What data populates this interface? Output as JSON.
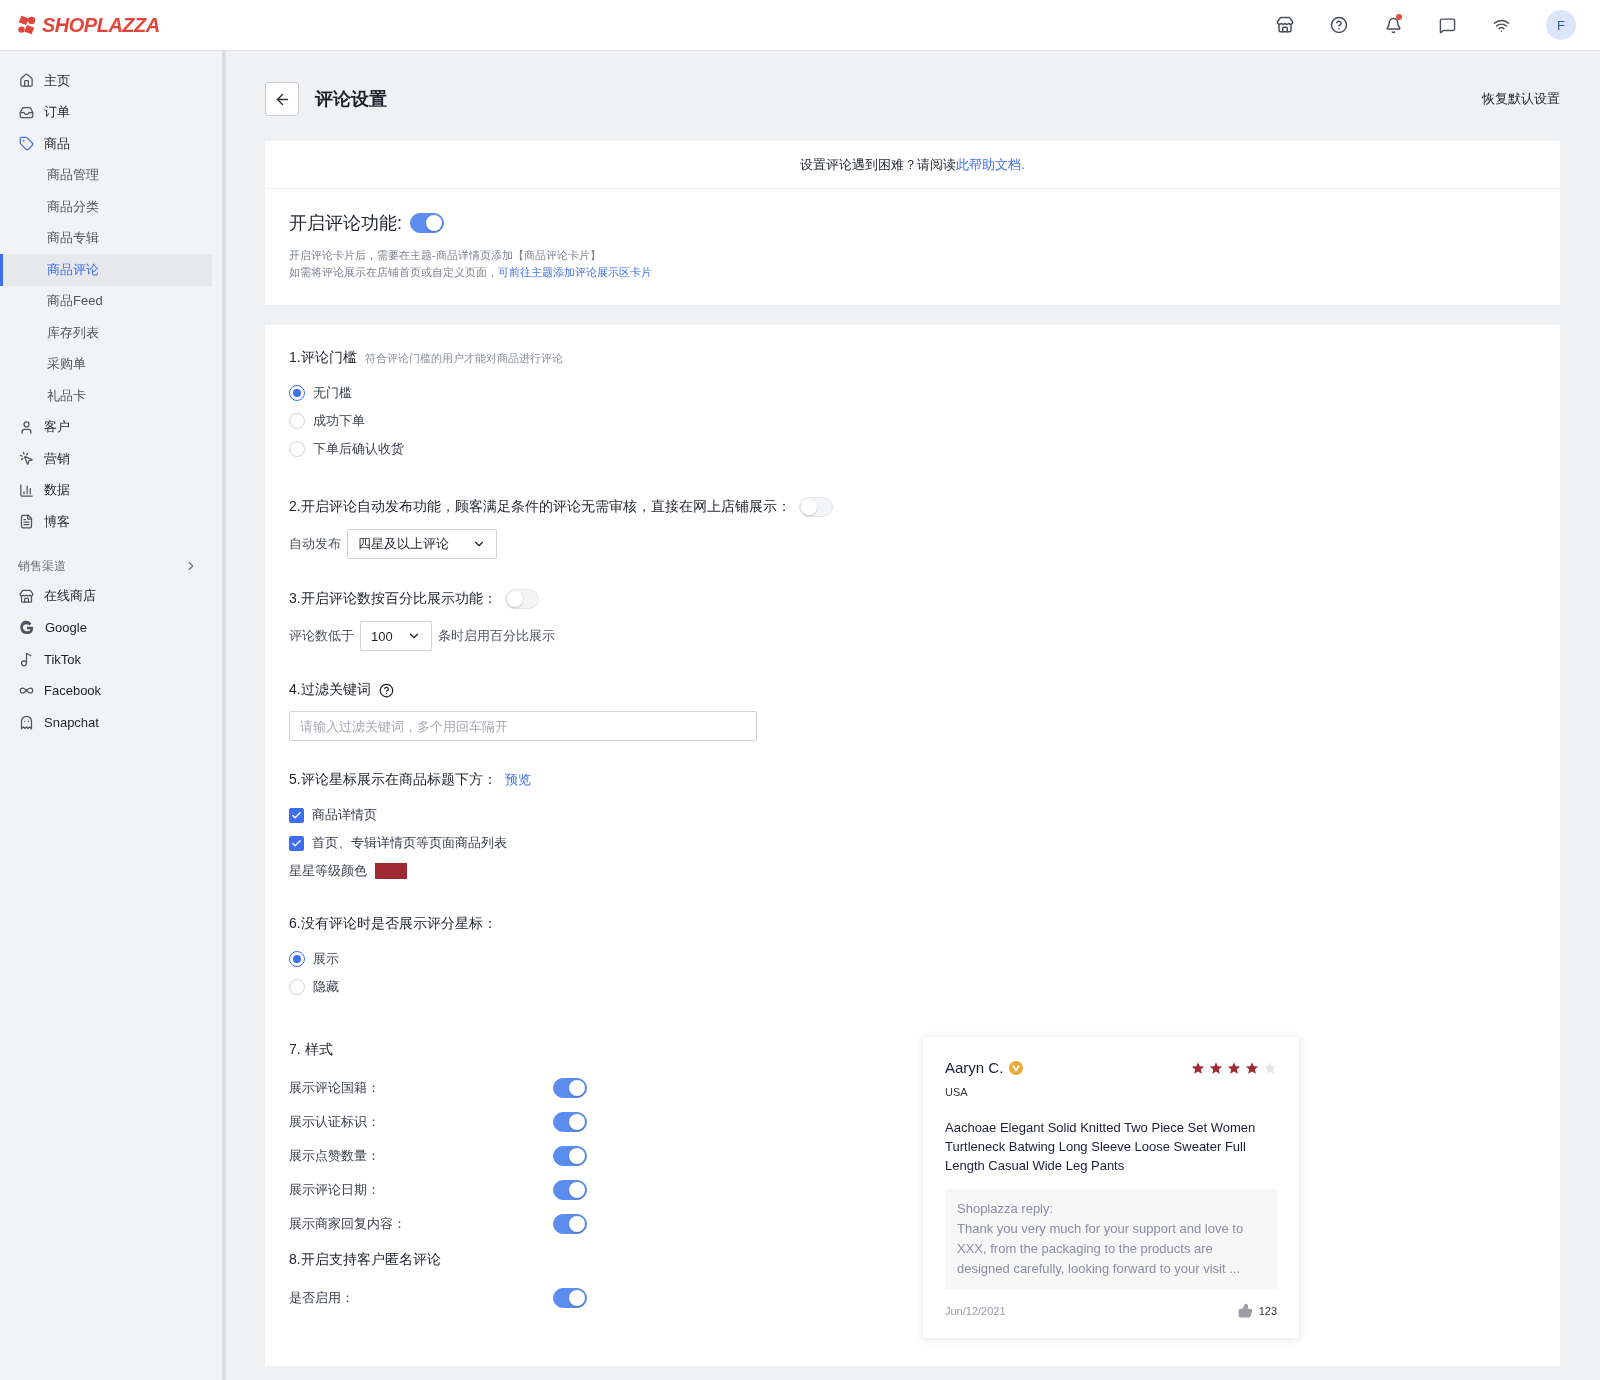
{
  "topbar": {
    "logo": "SHOPLAZZA",
    "has_notification": true,
    "avatar": "F"
  },
  "sidebar": {
    "items": [
      {
        "label": "主页",
        "selected": false
      },
      {
        "label": "订单",
        "selected": false
      },
      {
        "label": "商品",
        "selected": false,
        "expanded": true,
        "children": [
          {
            "label": "商品管理",
            "selected": false
          },
          {
            "label": "商品分类",
            "selected": false
          },
          {
            "label": "商品专辑",
            "selected": false
          },
          {
            "label": "商品评论",
            "selected": true
          },
          {
            "label": "商品Feed",
            "selected": false
          },
          {
            "label": "库存列表",
            "selected": false
          },
          {
            "label": "采购单",
            "selected": false
          },
          {
            "label": "礼品卡",
            "selected": false
          }
        ]
      },
      {
        "label": "客户",
        "selected": false
      },
      {
        "label": "营销",
        "selected": false
      },
      {
        "label": "数据",
        "selected": false
      },
      {
        "label": "博客",
        "selected": false
      }
    ],
    "channels_heading": "销售渠道",
    "channels": [
      {
        "label": "在线商店",
        "selected": false
      },
      {
        "label": "Google",
        "selected": false
      },
      {
        "label": "TikTok",
        "selected": false
      },
      {
        "label": "Facebook",
        "selected": false
      },
      {
        "label": "Snapchat",
        "selected": false
      }
    ]
  },
  "header": {
    "title": "评论设置",
    "reset": "恢复默认设置"
  },
  "help_bar": {
    "text": "设置评论遇到困难？请阅读",
    "link": "此帮助文档."
  },
  "enable": {
    "label": "开启评论功能:",
    "on": true,
    "note_1": "开启评论卡片后，需要在主题-商品详情页添加【商品评论卡片】",
    "note_2": "如需将评论展示在店铺首页或自定义页面，",
    "note_2_link": "可前往主题添加评论展示区卡片"
  },
  "sections": [
    {
      "kind": "radio",
      "title": "1.评论门槛",
      "hint": "符合评论门槛的用户才能对商品进行评论",
      "options": [
        {
          "label": "无门槛",
          "selected": true
        },
        {
          "label": "成功下单",
          "selected": false
        },
        {
          "label": "下单后确认收货",
          "selected": false
        }
      ]
    },
    {
      "kind": "toggleselect",
      "title": "2.开启评论自动发布功能，顾客满足条件的评论无需审核，直接在网上店铺展示：",
      "on": false,
      "select_label": "自动发布",
      "select_value": "四星及以上评论"
    },
    {
      "kind": "inlineselect",
      "title": "3.开启评论数按百分比展示功能：",
      "on": false,
      "prefix": "评论数低于",
      "select_value": "100",
      "suffix": "条时启用百分比展示"
    },
    {
      "kind": "keywords",
      "title": "4.过滤关键词",
      "placeholder": "请输入过滤关键词，多个用回车隔开"
    },
    {
      "kind": "checkboxes",
      "title": "5.评论星标展示在商品标题下方：",
      "link": "预览",
      "options": [
        {
          "label": "商品详情页",
          "checked": true
        },
        {
          "label": "首页、专辑详情页等页面商品列表",
          "checked": true
        }
      ],
      "color_label": "星星等级颜色",
      "color": "#9e2a33"
    },
    {
      "kind": "radio",
      "title": "6.没有评论时是否展示评分星标：",
      "options": [
        {
          "label": "展示",
          "selected": true
        },
        {
          "label": "隐藏",
          "selected": false
        }
      ]
    }
  ],
  "style_sections": [
    {
      "title": "7. 样式",
      "rows": [
        {
          "label": "展示评论国籍：",
          "on": true
        },
        {
          "label": "展示认证标识：",
          "on": true
        },
        {
          "label": "展示点赞数量：",
          "on": true
        },
        {
          "label": "展示评论日期：",
          "on": true
        },
        {
          "label": "展示商家回复内容：",
          "on": true
        }
      ]
    },
    {
      "title": "8.开启支持客户匿名评论",
      "rows": [
        {
          "label": "是否启用：",
          "on": true
        }
      ]
    }
  ],
  "preview": {
    "name": "Aaryn C.",
    "verified": true,
    "stars": 4,
    "country": "USA",
    "product": "Aachoae Elegant Solid Knitted Two Piece Set Women Turtleneck Batwing Long Sleeve Loose Sweater Full Length Casual Wide Leg Pants",
    "reply_title": "Shoplazza reply:",
    "reply": "Thank you very much for your support and love to XXX, from the packaging to the products are designed carefully, looking forward to your visit ...",
    "date": "Jun/12/2021",
    "likes": "123"
  }
}
